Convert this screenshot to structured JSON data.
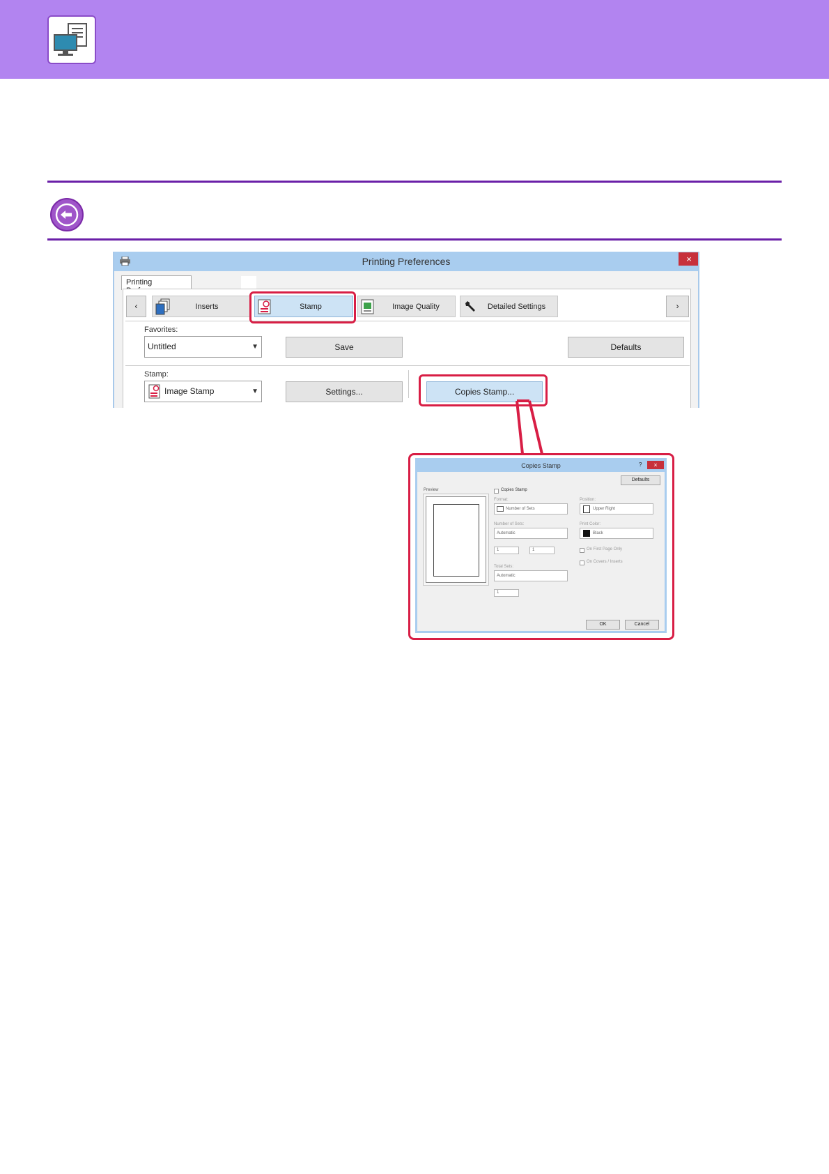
{
  "main_dialog": {
    "title": "Printing Preferences",
    "close_glyph": "×",
    "tab_label": "Printing Preferences",
    "nav_prev": "‹",
    "nav_next": "›",
    "tabs": [
      {
        "label": "Inserts",
        "icon": "inserts-icon"
      },
      {
        "label": "Stamp",
        "icon": "stamp-icon"
      },
      {
        "label": "Image Quality",
        "icon": "image-quality-icon"
      },
      {
        "label": "Detailed Settings",
        "icon": "wrench-icon"
      }
    ],
    "favorites_label": "Favorites:",
    "favorites_value": "Untitled",
    "save_label": "Save",
    "defaults_label": "Defaults",
    "stamp_label": "Stamp:",
    "stamp_value": "Image Stamp",
    "settings_label": "Settings...",
    "copies_stamp_label": "Copies Stamp..."
  },
  "sub_dialog": {
    "title": "Copies Stamp",
    "help_glyph": "?",
    "close_glyph": "×",
    "defaults_label": "Defaults",
    "preview_label": "Preview",
    "copies_stamp_checkbox": "Copies Stamp",
    "format_label": "Format:",
    "format_value": "Number of Sets",
    "position_label": "Position:",
    "position_value": "Upper Right",
    "number_of_sets_label": "Number of Sets:",
    "number_of_sets_value": "Automatic",
    "print_color_label": "Print Color:",
    "print_color_value": "Black",
    "field_a": "1",
    "field_b": "1",
    "first_page_only": "On First Page Only",
    "on_covers_inserts": "On Covers / Inserts",
    "total_sets_label": "Total Sets:",
    "total_sets_value": "Automatic",
    "field_c": "1",
    "ok_label": "OK",
    "cancel_label": "Cancel"
  },
  "colors": {
    "header_band": "#b284f0",
    "rule": "#6a1fa8",
    "highlight": "#d81e45",
    "titlebar": "#a9cdef"
  }
}
